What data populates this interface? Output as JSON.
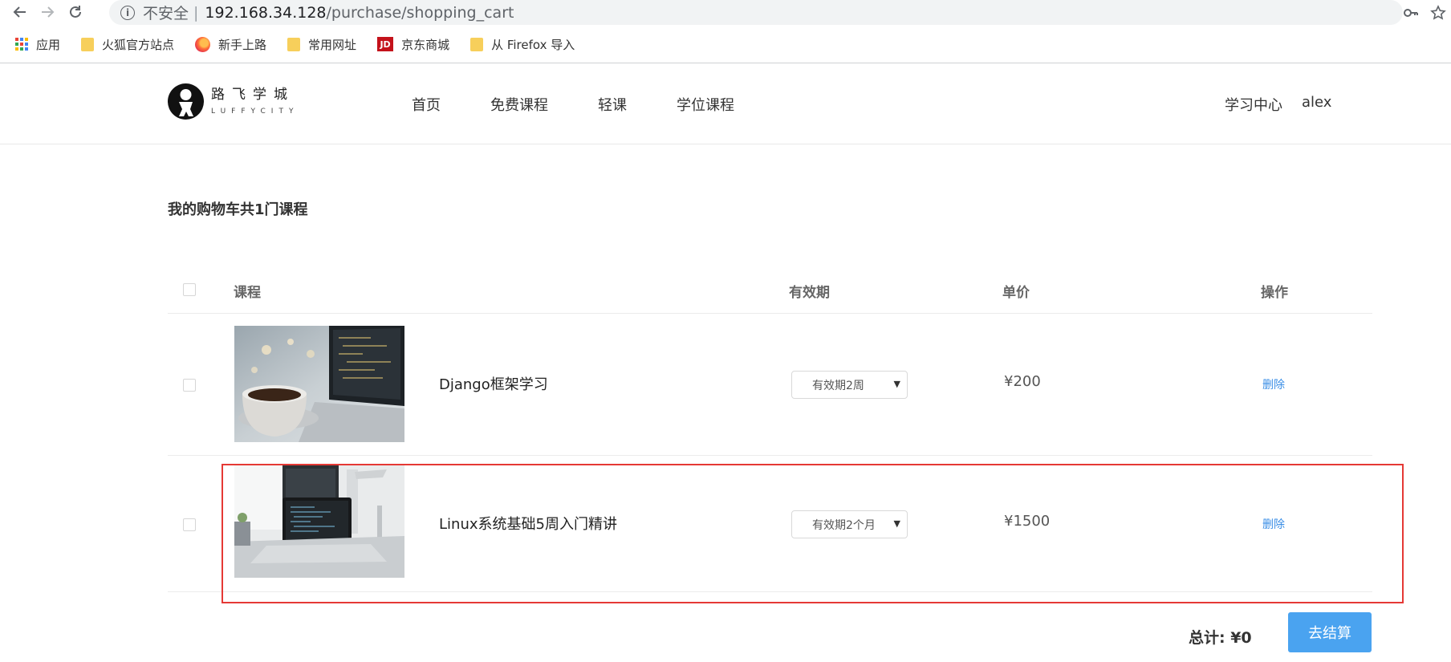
{
  "browser": {
    "insecure_label": "不安全",
    "separator": "|",
    "url_host": "192.168.34.128",
    "url_path": "/purchase/shopping_cart",
    "bookmarks": [
      {
        "label": "应用",
        "icon": "apps-grid-icon"
      },
      {
        "label": "火狐官方站点",
        "icon": "folder-icon"
      },
      {
        "label": "新手上路",
        "icon": "firefox-icon"
      },
      {
        "label": "常用网址",
        "icon": "folder-icon"
      },
      {
        "label": "京东商城",
        "icon": "jd-icon",
        "icon_text": "JD"
      },
      {
        "label": "从 Firefox 导入",
        "icon": "folder-icon"
      }
    ]
  },
  "site": {
    "logo_cn": "路飞学城",
    "logo_en": "LUFFYCITY",
    "nav": [
      "首页",
      "免费课程",
      "轻课",
      "学位课程"
    ],
    "user_nav": {
      "learning_center": "学习中心",
      "username": "alex"
    }
  },
  "cart": {
    "title": "我的购物车共1门课程",
    "headers": {
      "course": "课程",
      "period": "有效期",
      "price": "单价",
      "action": "操作"
    },
    "items": [
      {
        "name": "Django框架学习",
        "period": "有效期2周",
        "price": "¥200",
        "delete": "删除"
      },
      {
        "name": "Linux系统基础5周入门精讲",
        "period": "有效期2个月",
        "price": "¥1500",
        "delete": "删除"
      }
    ],
    "total": "总计: ¥0",
    "checkout": "去结算"
  },
  "colors": {
    "accent": "#4aa3f0",
    "link": "#3a8ee6",
    "highlight": "#e53935"
  }
}
